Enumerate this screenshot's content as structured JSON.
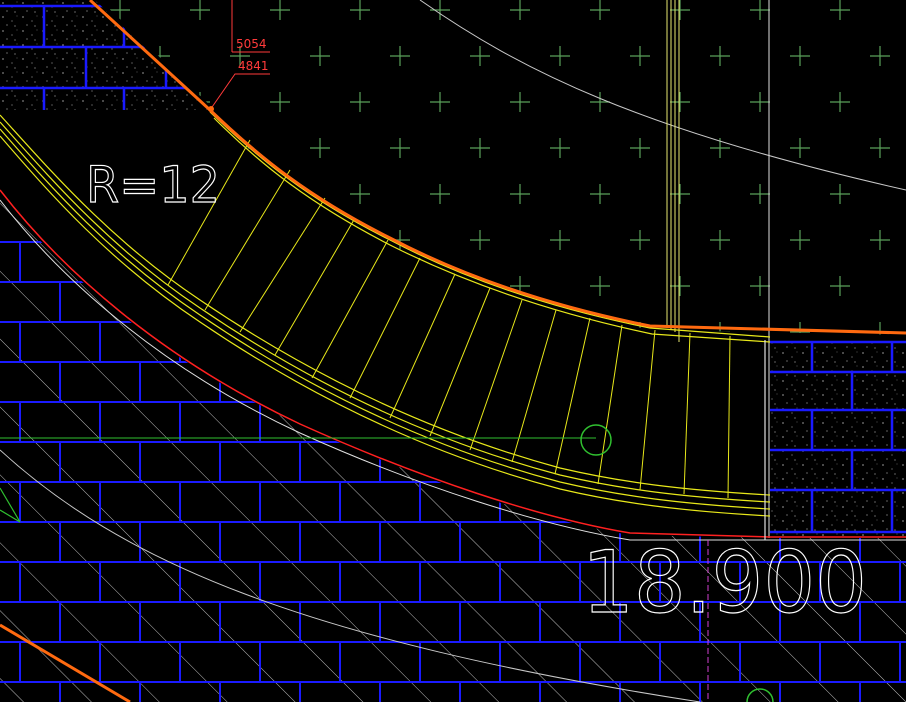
{
  "drawing": {
    "radius_label": "R=12",
    "dimension_text": "18.900",
    "leader_labels": [
      "5054",
      "4841"
    ]
  },
  "colors": {
    "background": "#000000",
    "brick": "#1a1aff",
    "hatch": "#c8c8c8",
    "curb": "#e8e81a",
    "edge_orange": "#ff6a10",
    "edge_red": "#ff2020",
    "plant_cross": "#5aa05a",
    "dot": "#ffffff",
    "text_white": "#ffffff",
    "leader_red": "#ff3a3a",
    "marker_green": "#30c030",
    "axis_magenta": "#d040d0"
  }
}
